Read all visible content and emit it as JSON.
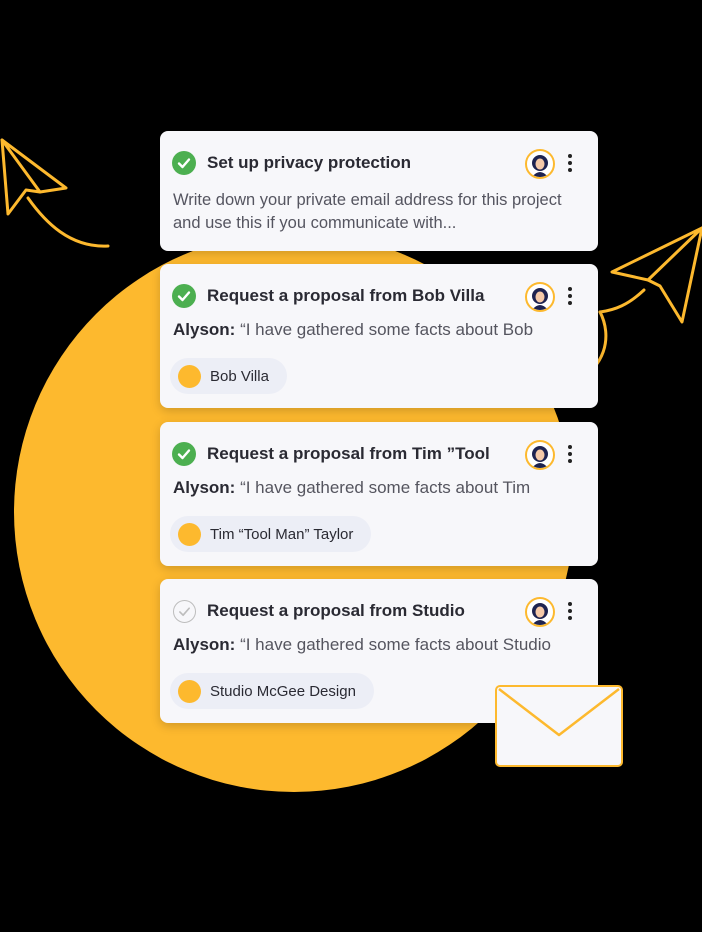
{
  "colors": {
    "accent": "#FDB92E",
    "check_done": "#4CAF50",
    "card_bg": "#F7F7FA",
    "chip_bg": "#ECEEF6"
  },
  "tasks": [
    {
      "status": "done",
      "title": "Set up privacy protection",
      "description": "Write down your private email address for this project and use this if you communicate with..."
    },
    {
      "status": "done",
      "title": "Request a proposal from Bob Villa",
      "author": "Alyson:",
      "quote": " “I have gathered some facts about Bob",
      "chip": "Bob Villa"
    },
    {
      "status": "done",
      "title": "Request a proposal from Tim ”Tool",
      "author": "Alyson:",
      "quote": " “I have gathered some facts about Tim",
      "chip": "Tim “Tool Man” Taylor"
    },
    {
      "status": "open",
      "title": "Request a proposal from Studio",
      "author": "Alyson:",
      "quote": " “I have gathered some facts about Studio",
      "chip": "Studio McGee Design"
    }
  ],
  "icons": [
    "check-icon",
    "avatar-icon",
    "more-vertical-icon",
    "paper-plane-icon",
    "envelope-icon"
  ]
}
